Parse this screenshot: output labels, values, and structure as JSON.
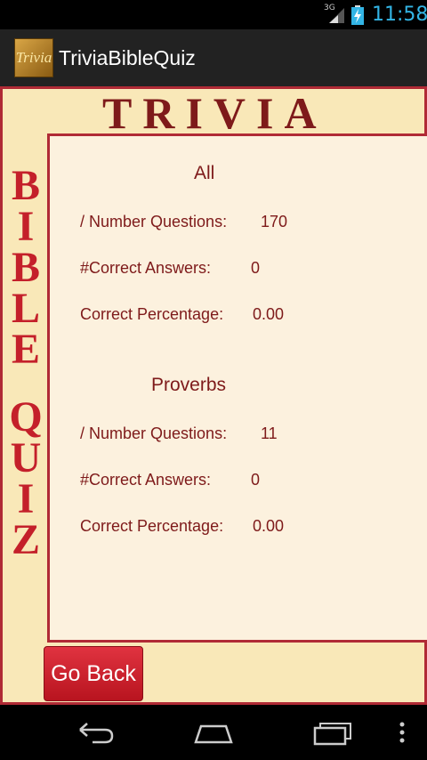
{
  "status_bar": {
    "network": "3G",
    "time": "11:58"
  },
  "action_bar": {
    "icon_text": "Trivia",
    "title": "TriviaBibleQuiz"
  },
  "banner": {
    "top": "TRIVIA",
    "side_letters_1": [
      "B",
      "I",
      "B",
      "L",
      "E"
    ],
    "side_letters_2": [
      "Q",
      "U",
      "I",
      "Z"
    ]
  },
  "sections": [
    {
      "title": "All",
      "rows": [
        {
          "label": "/ Number Questions:",
          "value": "170"
        },
        {
          "label": "#Correct Answers:",
          "value": "0"
        },
        {
          "label": "Correct Percentage:",
          "value": "0.00"
        }
      ]
    },
    {
      "title": "Proverbs",
      "rows": [
        {
          "label": "/ Number Questions:",
          "value": "11"
        },
        {
          "label": "#Correct Answers:",
          "value": "0"
        },
        {
          "label": "Correct Percentage:",
          "value": "0.00"
        }
      ]
    }
  ],
  "go_back_label": "Go Back",
  "colors": {
    "accent_red": "#b02a35",
    "text_dark_red": "#7e1a1a",
    "background_cream": "#f9e8b8",
    "status_blue": "#33b5e5"
  },
  "nav_icons": [
    "back-icon",
    "home-icon",
    "recent-apps-icon",
    "overflow-menu-icon"
  ]
}
